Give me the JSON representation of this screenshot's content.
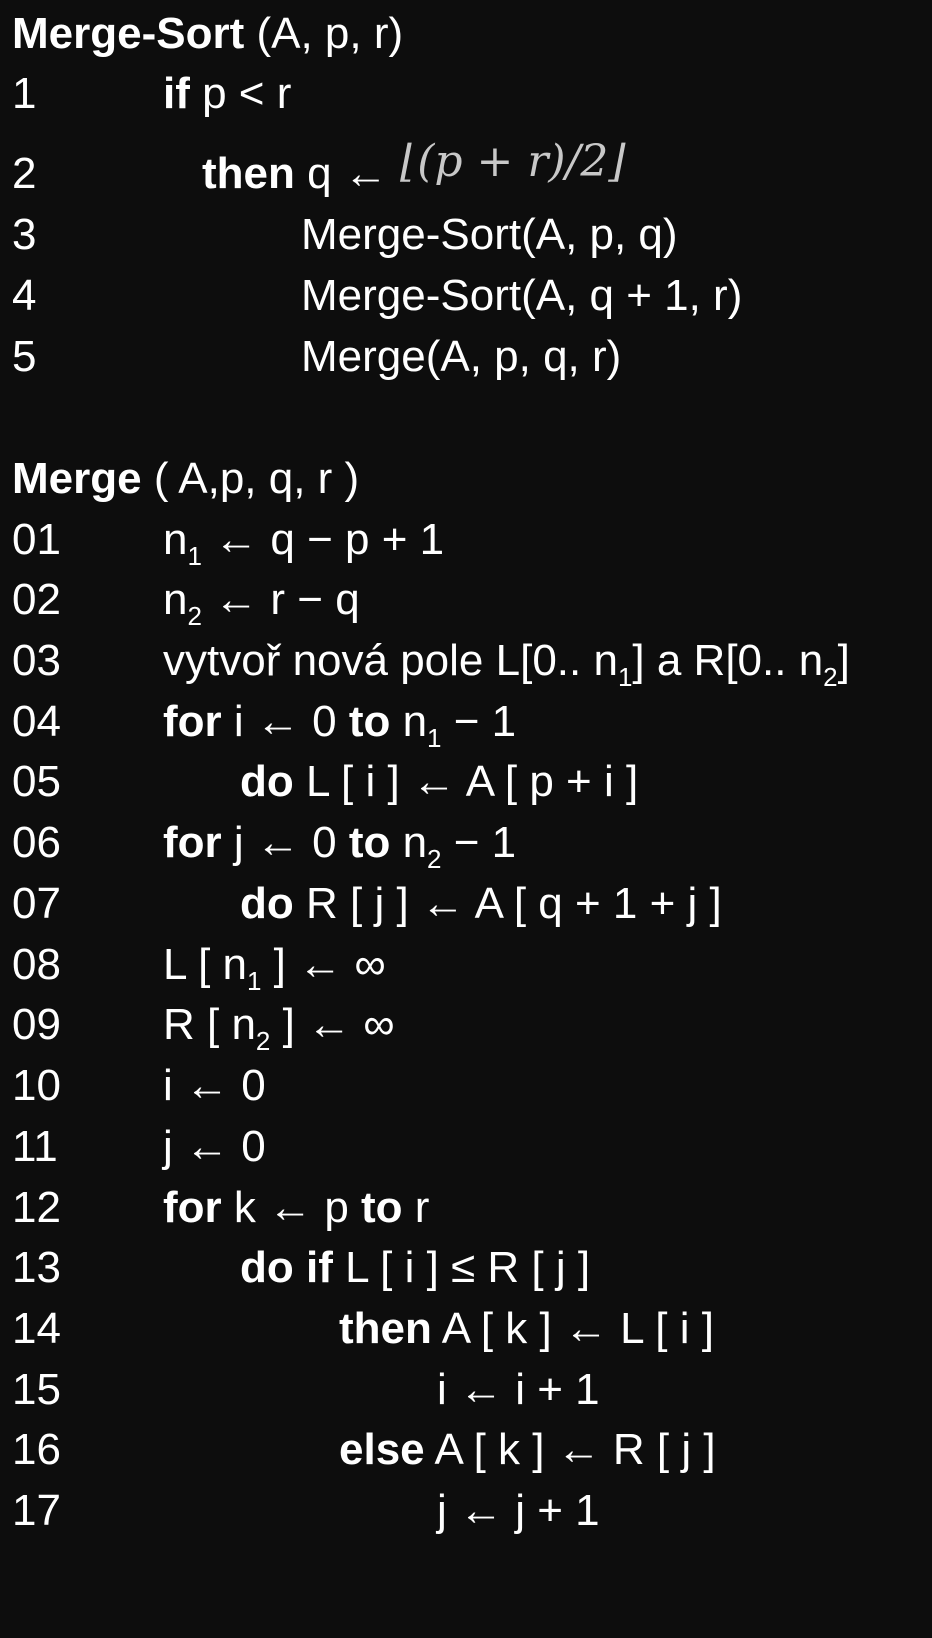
{
  "merge_sort": {
    "title_bold": "Merge-Sort",
    "title_args": " (A, p, r)",
    "lines": [
      {
        "num": "1",
        "kw": "if",
        "text": " p < r"
      },
      {
        "num": "2",
        "kw": "then",
        "text": " q ← ",
        "formula": "⌊(p + r)/2⌋"
      },
      {
        "num": "3",
        "text": "Merge-Sort(A, p, q)"
      },
      {
        "num": "4",
        "text": "Merge-Sort(A, q + 1, r)"
      },
      {
        "num": "5",
        "text": "Merge(A, p, q, r)"
      }
    ]
  },
  "merge": {
    "title_bold": "Merge",
    "title_args": " ( A,p, q, r )",
    "lines": [
      {
        "num": "01",
        "segments": [
          "n",
          "1",
          " ← q − p + 1"
        ]
      },
      {
        "num": "02",
        "segments": [
          "n",
          "2",
          " ← r − q"
        ]
      },
      {
        "num": "03",
        "segments": [
          "vytvoř nová pole L[0.. n",
          "1",
          "] a R[0.. n",
          "2",
          "]"
        ]
      },
      {
        "num": "04",
        "kw1": "for",
        "t1": " i ← 0 ",
        "kw2": "to",
        "t2": " n",
        "sub": "1",
        "t3": " − 1"
      },
      {
        "num": "05",
        "kw": "do",
        "text": " L [ i ] ← A [ p + i ]"
      },
      {
        "num": "06",
        "kw1": "for",
        "t1": " j ← 0 ",
        "kw2": "to",
        "t2": " n",
        "sub": "2",
        "t3": " − 1"
      },
      {
        "num": "07",
        "kw": "do",
        "text": " R [ j ] ← A [ q + 1 + j ]"
      },
      {
        "num": "08",
        "t1": "L [ n",
        "sub": "1",
        "t2": " ] ← ∞"
      },
      {
        "num": "09",
        "t1": "R [ n",
        "sub": "2",
        "t2": " ] ← ∞"
      },
      {
        "num": "10",
        "text": "i ← 0"
      },
      {
        "num": "11",
        "text": "j ← 0"
      },
      {
        "num": "12",
        "kw1": "for",
        "t1": " k ← p ",
        "kw2": "to",
        "t2": " r"
      },
      {
        "num": "13",
        "kw": "do if",
        "text": " L [ i ] ≤ R [ j ]"
      },
      {
        "num": "14",
        "kw": "then",
        "text": " A [ k ] ← L [ i ]"
      },
      {
        "num": "15",
        "text": "i ← i + 1"
      },
      {
        "num": "16",
        "kw": "else",
        "text": " A [ k ] ← R [ j ]"
      },
      {
        "num": "17",
        "text": "j ← j + 1"
      }
    ]
  }
}
